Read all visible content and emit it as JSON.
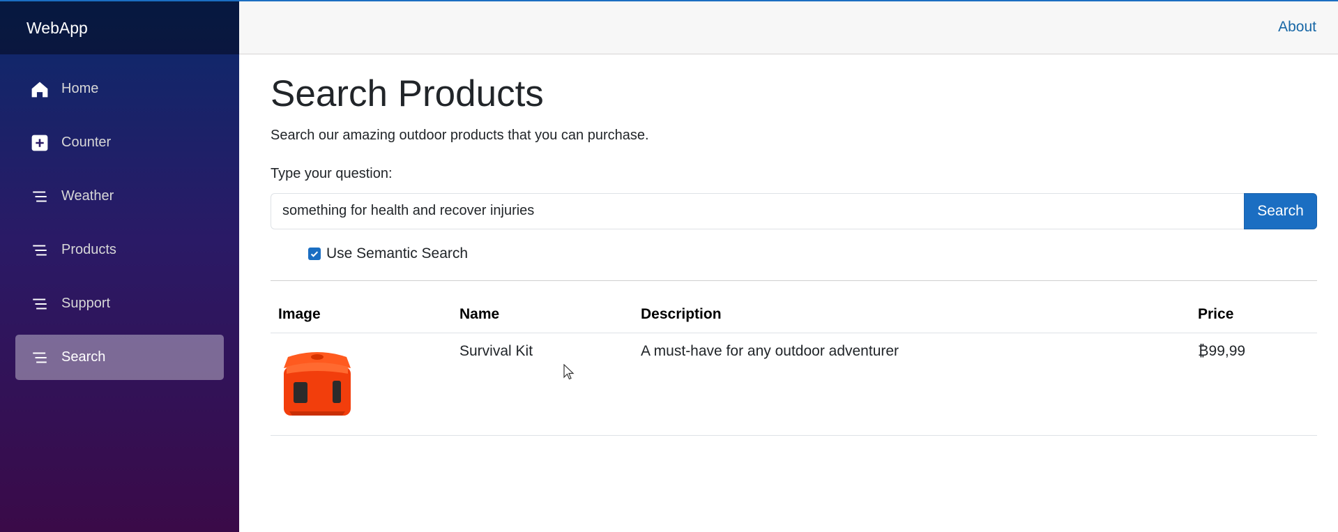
{
  "app": {
    "brand": "WebApp",
    "about_label": "About"
  },
  "sidebar": {
    "items": [
      {
        "label": "Home",
        "icon": "home-icon"
      },
      {
        "label": "Counter",
        "icon": "plus-square-icon"
      },
      {
        "label": "Weather",
        "icon": "list-icon"
      },
      {
        "label": "Products",
        "icon": "list-icon"
      },
      {
        "label": "Support",
        "icon": "list-icon"
      },
      {
        "label": "Search",
        "icon": "list-icon",
        "active": true
      }
    ]
  },
  "page": {
    "title": "Search Products",
    "subtitle": "Search our amazing outdoor products that you can purchase.",
    "question_label": "Type your question:",
    "search_value": "something for health and recover injuries",
    "search_button": "Search",
    "semantic_label": "Use Semantic Search",
    "semantic_checked": true
  },
  "table": {
    "headers": [
      "Image",
      "Name",
      "Description",
      "Price"
    ],
    "rows": [
      {
        "image": "orange-survival-kit-case",
        "name": "Survival Kit",
        "description": "A must-have for any outdoor adventurer",
        "price": "₿99,99"
      }
    ]
  },
  "colors": {
    "accent": "#1b6ec2",
    "sidebar_top": "#0b2a6b",
    "sidebar_bottom": "#3a0a48",
    "link": "#1767a6"
  }
}
